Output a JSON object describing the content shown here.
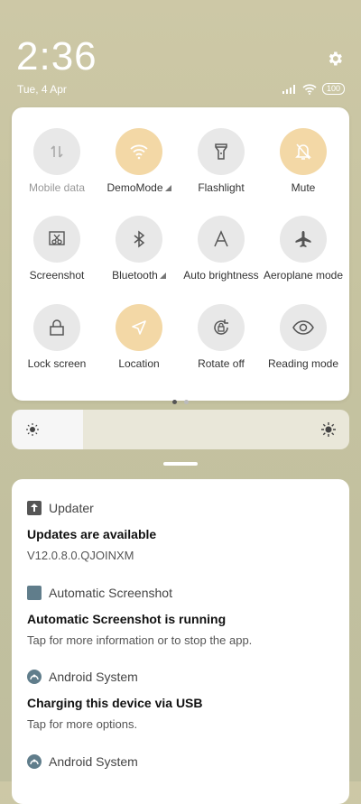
{
  "header": {
    "time": "2:36",
    "date": "Tue, 4 Apr",
    "battery": "100",
    "settings_icon": "gear-icon"
  },
  "quick_settings": {
    "tiles": [
      {
        "label": "Mobile data",
        "icon": "mobile-data-icon",
        "state": "off"
      },
      {
        "label": "DemoMode",
        "icon": "wifi-icon",
        "state": "on"
      },
      {
        "label": "Flashlight",
        "icon": "flashlight-icon",
        "state": "off"
      },
      {
        "label": "Mute",
        "icon": "bell-off-icon",
        "state": "on"
      },
      {
        "label": "Screenshot",
        "icon": "screenshot-icon",
        "state": "off"
      },
      {
        "label": "Bluetooth",
        "icon": "bluetooth-icon",
        "state": "off"
      },
      {
        "label": "Auto brightness",
        "icon": "auto-brightness-icon",
        "state": "off"
      },
      {
        "label": "Aeroplane mode",
        "icon": "airplane-icon",
        "state": "off"
      },
      {
        "label": "Lock screen",
        "icon": "lock-icon",
        "state": "off"
      },
      {
        "label": "Location",
        "icon": "location-icon",
        "state": "on"
      },
      {
        "label": "Rotate off",
        "icon": "rotate-icon",
        "state": "off"
      },
      {
        "label": "Reading mode",
        "icon": "eye-icon",
        "state": "off"
      }
    ],
    "page_count": 2,
    "active_page": 1
  },
  "brightness": {
    "level": 0.21
  },
  "notifications": [
    {
      "app": "Updater",
      "title": "Updates are available",
      "body": "V12.0.8.0.QJOINXM",
      "icon": "arrow-up-icon"
    },
    {
      "app": "Automatic Screenshot",
      "title": "Automatic Screenshot is running",
      "body": "Tap for more information or to stop the app.",
      "icon": "app-square-icon"
    },
    {
      "app": "Android System",
      "title": "Charging this device via USB",
      "body": "Tap for more options.",
      "icon": "android-system-icon"
    },
    {
      "app": "Android System",
      "title": "",
      "body": "",
      "icon": "android-system-icon"
    }
  ],
  "colors": {
    "tile_on": "#f3d8a6",
    "tile_off": "#e8e8e8",
    "accent_icon": "#607d8b"
  }
}
